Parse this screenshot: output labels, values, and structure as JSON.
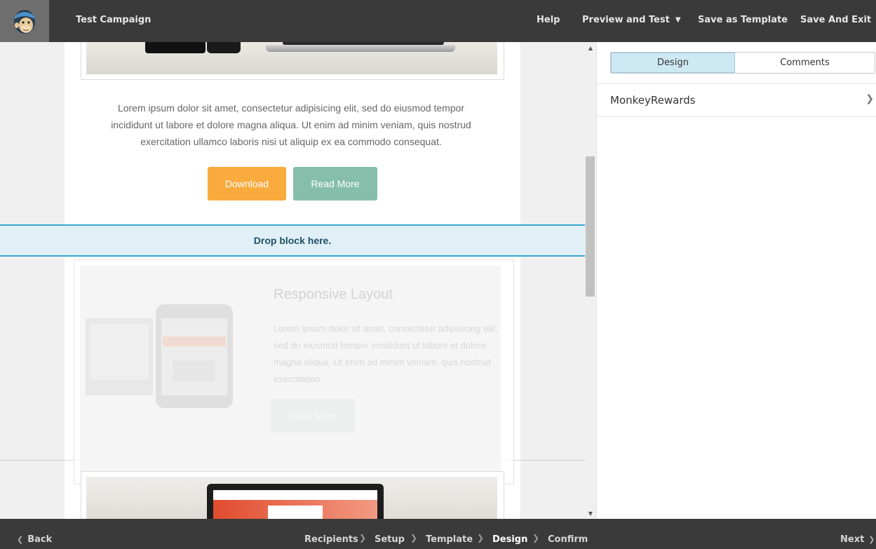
{
  "topbar": {
    "campaign_title": "Test Campaign",
    "help": "Help",
    "preview_and_test": "Preview and Test",
    "save_as_template": "Save as Template",
    "save_and_exit": "Save And Exit"
  },
  "email": {
    "lorem_text": "Lorem ipsum dolor sit amet, consectetur adipisicing elit, sed do eiusmod tempor incididunt ut labore et dolore magna aliqua. Ut enim ad minim veniam, quis nostrud exercitation ullamco laboris nisi ut aliquip ex ea commodo consequat.",
    "download_label": "Download",
    "read_more_label": "Read More",
    "drop_label": "Drop block here.",
    "ghost": {
      "title": "Responsive Layout",
      "text": "Lorem ipsum dolor sit amet, consectetur adipisicing elit, sed do eiusmod tempor incididunt ut labore et dolore magna aliqua. Ut enim ad minim veniam, quis nostrud exercitation.",
      "button": "Read More"
    },
    "colors": {
      "download": "#f9ab3d",
      "read_more": "#86beac",
      "drop_border": "#37a8d4"
    }
  },
  "panel": {
    "tab_design": "Design",
    "tab_comments": "Comments",
    "row_label": "MonkeyRewards"
  },
  "bottombar": {
    "back": "Back",
    "steps": [
      "Recipients",
      "Setup",
      "Template",
      "Design",
      "Confirm"
    ],
    "active_step": "Design",
    "next": "Next"
  },
  "icons": {
    "logo": "mailchimp-logo-icon",
    "chevron_down": "chevron-down-icon",
    "chevron_right": "chevron-right-icon",
    "chevron_left": "chevron-left-icon"
  }
}
